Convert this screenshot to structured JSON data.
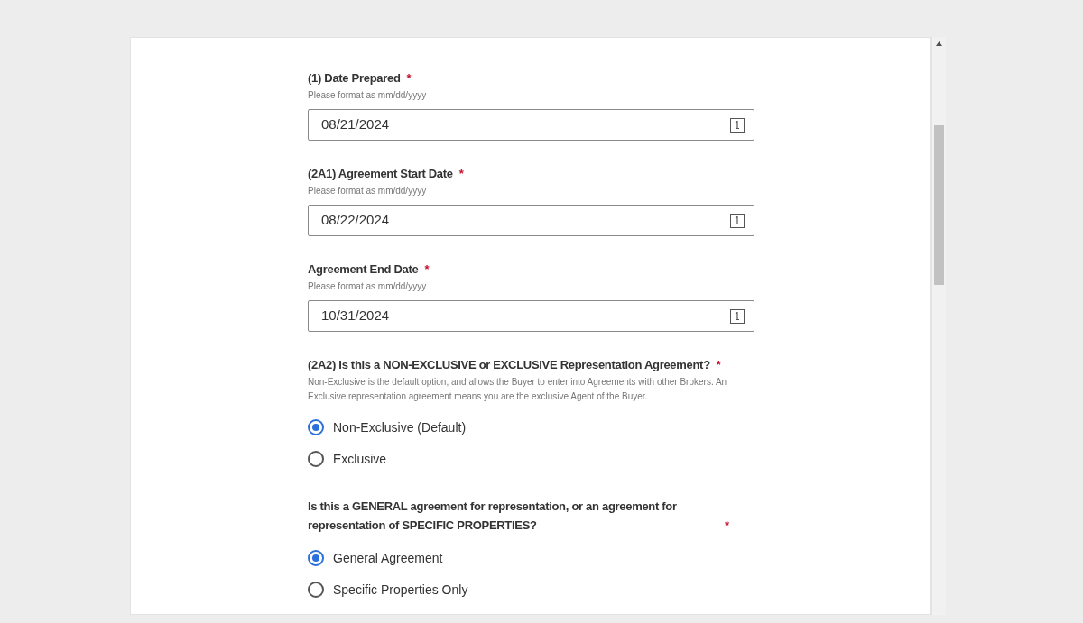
{
  "fields": [
    {
      "kind": "date",
      "label": "(1) Date Prepared",
      "required_mark": "*",
      "hint": "Please format as mm/dd/yyyy",
      "value": "08/21/2024"
    },
    {
      "kind": "date",
      "label": "(2A1) Agreement Start Date",
      "required_mark": "*",
      "hint": "Please format as mm/dd/yyyy",
      "value": "08/22/2024"
    },
    {
      "kind": "date",
      "label": "Agreement End Date",
      "required_mark": "*",
      "hint": "Please format as mm/dd/yyyy",
      "value": "10/31/2024"
    },
    {
      "kind": "radio",
      "label": "(2A2) Is this a NON-EXCLUSIVE or EXCLUSIVE Representation Agreement?",
      "required_mark": "*",
      "hint": "Non-Exclusive is the default option, and allows the Buyer to enter into Agreements with other Brokers. An Exclusive representation agreement means you are the exclusive Agent of the Buyer.",
      "options": [
        {
          "label": "Non-Exclusive (Default)",
          "selected": true
        },
        {
          "label": "Exclusive",
          "selected": false
        }
      ]
    },
    {
      "kind": "radio",
      "label": "Is this a GENERAL agreement for representation, or an agreement for representation of SPECIFIC PROPERTIES?",
      "required_mark": "*",
      "options": [
        {
          "label": "General Agreement",
          "selected": true
        },
        {
          "label": "Specific Properties Only",
          "selected": false
        }
      ]
    }
  ]
}
